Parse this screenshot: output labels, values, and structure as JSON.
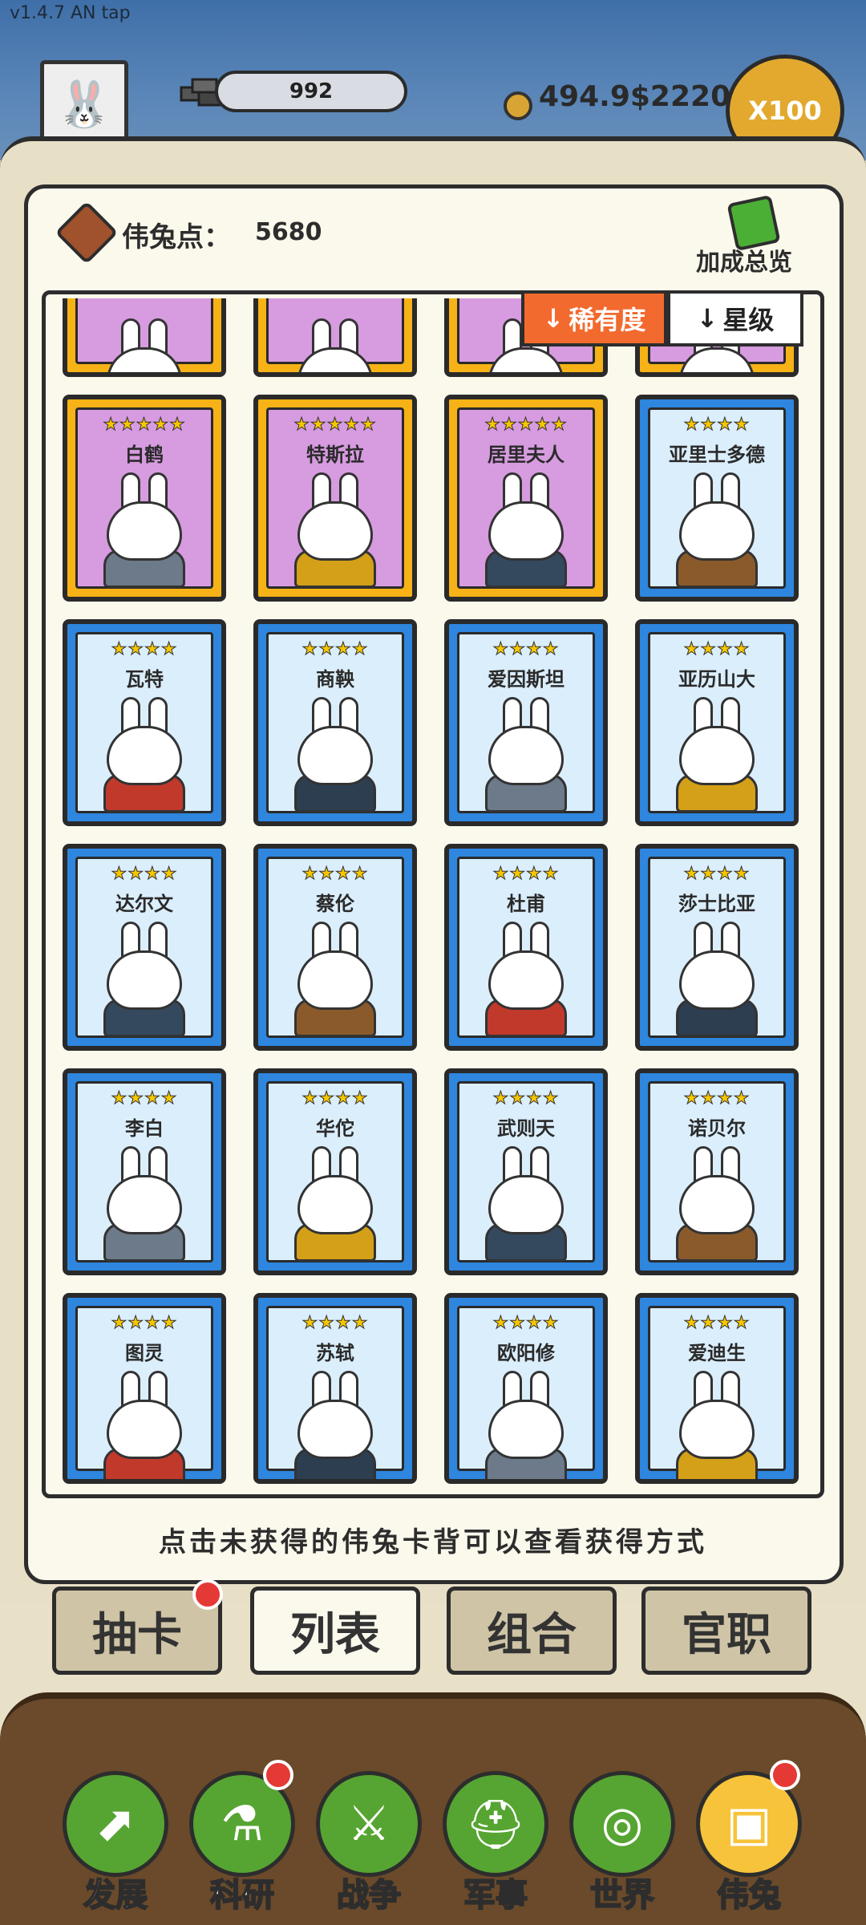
{
  "app": {
    "version": "v1.4.7 AN tap"
  },
  "top_bar": {
    "avatar_icon": "rabbit-avatar-icon",
    "supply_value": "992",
    "money": "494.9$2220",
    "multiplier": "X100"
  },
  "header": {
    "points_label": "伟兔点：",
    "points_value": "5680",
    "bonus_label": "加成总览"
  },
  "sort": {
    "rarity_label": "稀有度",
    "star_label": "星级"
  },
  "cards": [
    {
      "name": "",
      "stars": "",
      "tier": "legend"
    },
    {
      "name": "",
      "stars": "",
      "tier": "legend"
    },
    {
      "name": "",
      "stars": "",
      "tier": "legend"
    },
    {
      "name": "",
      "stars": "",
      "tier": "legend"
    },
    {
      "name": "白鹤",
      "stars": "★★★★★",
      "tier": "legend"
    },
    {
      "name": "特斯拉",
      "stars": "★★★★★",
      "tier": "legend"
    },
    {
      "name": "居里夫人",
      "stars": "★★★★★",
      "tier": "legend"
    },
    {
      "name": "亚里士多德",
      "stars": "★★★★",
      "tier": "rare"
    },
    {
      "name": "瓦特",
      "stars": "★★★★",
      "tier": "rare"
    },
    {
      "name": "商鞅",
      "stars": "★★★★",
      "tier": "rare"
    },
    {
      "name": "爱因斯坦",
      "stars": "★★★★",
      "tier": "rare"
    },
    {
      "name": "亚历山大",
      "stars": "★★★★",
      "tier": "rare"
    },
    {
      "name": "达尔文",
      "stars": "★★★★",
      "tier": "rare"
    },
    {
      "name": "蔡伦",
      "stars": "★★★★",
      "tier": "rare"
    },
    {
      "name": "杜甫",
      "stars": "★★★★",
      "tier": "rare"
    },
    {
      "name": "莎士比亚",
      "stars": "★★★★",
      "tier": "rare"
    },
    {
      "name": "李白",
      "stars": "★★★★",
      "tier": "rare"
    },
    {
      "name": "华佗",
      "stars": "★★★★",
      "tier": "rare"
    },
    {
      "name": "武则天",
      "stars": "★★★★",
      "tier": "rare"
    },
    {
      "name": "诺贝尔",
      "stars": "★★★★",
      "tier": "rare"
    },
    {
      "name": "图灵",
      "stars": "★★★★",
      "tier": "rare"
    },
    {
      "name": "苏轼",
      "stars": "★★★★",
      "tier": "rare"
    },
    {
      "name": "欧阳修",
      "stars": "★★★★",
      "tier": "rare"
    },
    {
      "name": "爱迪生",
      "stars": "★★★★",
      "tier": "rare"
    }
  ],
  "hint": "点击未获得的伟兔卡背可以查看获得方式",
  "tabs": [
    {
      "label": "抽卡",
      "badge": true
    },
    {
      "label": "列表",
      "active": true
    },
    {
      "label": "组合"
    },
    {
      "label": "官职"
    }
  ],
  "nav": [
    {
      "label": "发展",
      "icon": "arrow-up-icon"
    },
    {
      "label": "科研",
      "icon": "flask-icon",
      "badge": true
    },
    {
      "label": "战争",
      "icon": "crossed-swords-icon"
    },
    {
      "label": "军事",
      "icon": "helmet-icon"
    },
    {
      "label": "世界",
      "icon": "globe-icon"
    },
    {
      "label": "伟兔",
      "icon": "rabbit-card-icon",
      "badge": true,
      "active": true
    }
  ]
}
